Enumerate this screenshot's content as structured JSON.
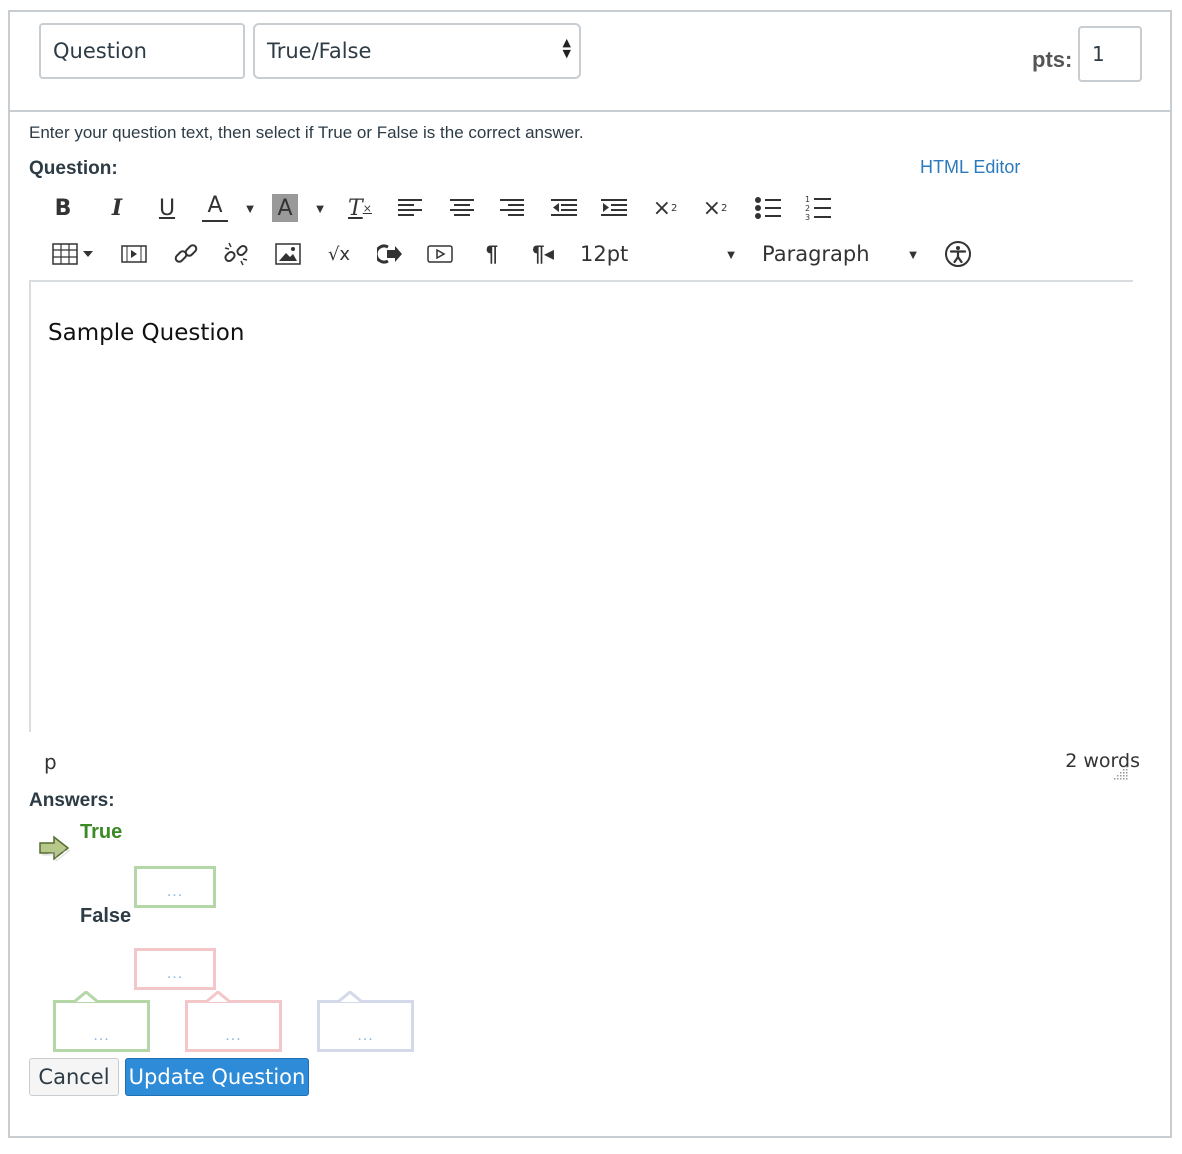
{
  "header": {
    "question_name": "Question",
    "question_type": "True/False",
    "points_label": "pts:",
    "points_value": "1"
  },
  "instructions": "Enter your question text, then select if True or False is the correct answer.",
  "question_label": "Question:",
  "html_editor_link": "HTML Editor",
  "toolbar": {
    "font_size": "12pt",
    "block_format": "Paragraph",
    "icons_row1": [
      "bold-icon",
      "italic-icon",
      "underline-icon",
      "text-color-icon",
      "dropdown-caret-icon",
      "background-color-icon",
      "dropdown-caret-icon",
      "clear-formatting-icon",
      "align-left-icon",
      "align-center-icon",
      "align-right-icon",
      "outdent-icon",
      "indent-icon",
      "superscript-icon",
      "subscript-icon",
      "bullet-list-icon",
      "numbered-list-icon"
    ],
    "icons_row2": [
      "table-icon",
      "media-icon",
      "link-icon",
      "unlink-icon",
      "image-icon",
      "equation-icon",
      "embed-icon",
      "video-icon",
      "ltr-icon",
      "rtl-icon",
      "accessibility-icon"
    ]
  },
  "editor": {
    "content": "Sample Question",
    "path": "p",
    "word_count": "2 words"
  },
  "answers": {
    "label": "Answers:",
    "items": [
      {
        "label": "True",
        "correct": true,
        "color": "#3b8a26"
      },
      {
        "label": "False",
        "correct": false,
        "color": "#2d3b45"
      }
    ],
    "comment_placeholder": "..."
  },
  "buttons": {
    "cancel": "Cancel",
    "update": "Update Question"
  },
  "colors": {
    "accent": "#2d8bd8",
    "link": "#2b7abc",
    "correct_green": "#b5d7a7",
    "incorrect_red": "#f3c7c9",
    "neutral_gray": "#d3d9e8"
  }
}
